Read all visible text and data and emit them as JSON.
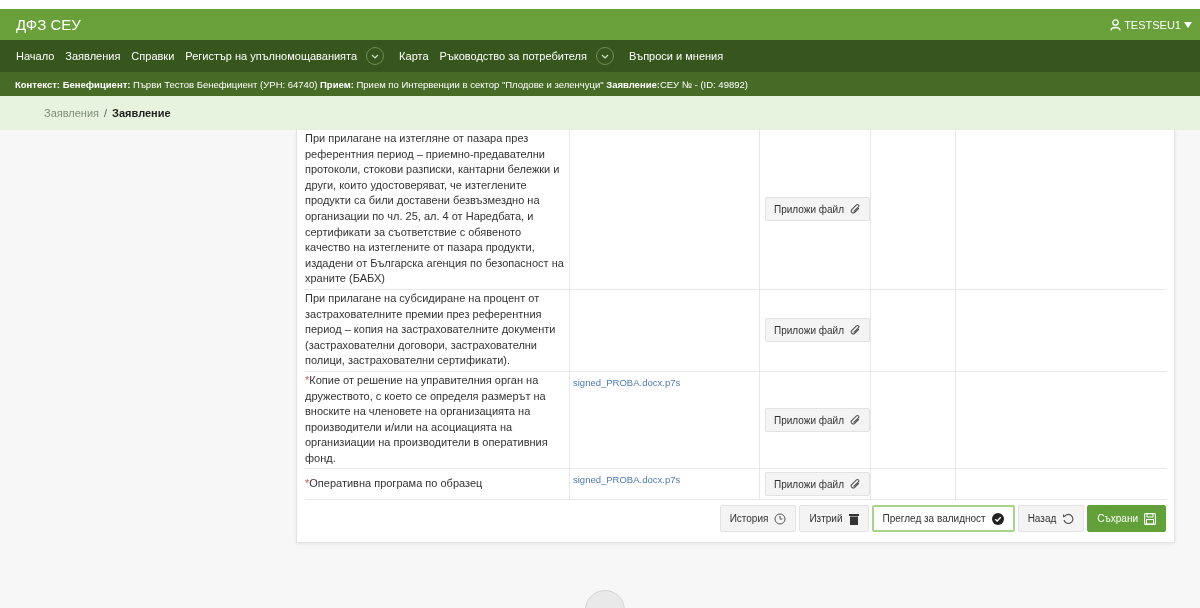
{
  "header": {
    "brand": "ДФЗ СЕУ",
    "user": "TESTSEU1"
  },
  "nav": [
    {
      "label": "Начало",
      "dropdown": false
    },
    {
      "label": "Заявления",
      "dropdown": false
    },
    {
      "label": "Справки",
      "dropdown": false
    },
    {
      "label": "Регистър на упълномощаванията",
      "dropdown": true
    },
    {
      "label": "Карта",
      "dropdown": false
    },
    {
      "label": "Ръководство за потребителя",
      "dropdown": true
    },
    {
      "label": "Въпроси и мнения",
      "dropdown": false
    }
  ],
  "context": "**Контекст: Бенефициент:** Първи Тестов Бенефициент (УРН: 64740) **Прием:** Прием по Интервенции в сектор \"Плодове и зеленчуци\" **Заявление:**СЕУ № - (ID: 49892)",
  "breadcrumb": [
    {
      "label": "Заявления",
      "current": false
    },
    {
      "label": "Заявление",
      "current": true
    }
  ],
  "breadcrumb_separator": "/",
  "required_mark": "*",
  "documents": [
    {
      "text": "При прилагане на изтегляне от пазара през референтния период – приемно-предавателни протоколи, стокови разписки, кантарни бележки и други, които удостоверяват, че изтеглените продукти са били доставени безвъзмездно на организации по чл. 25, ал. 4 от Наредбата, и сертификати за съответствие с обявеното качество на изтеглените от пазара продукти, издадени от Българска агенция по безопасност на храните (БАБХ)",
      "required": false,
      "attach": "Приложи файл"
    },
    {
      "text": "При прилагане на субсидиране на процент от застрахователните премии през референтния период – копия на застрахователните документи (застрахователни договори, застрахователни полици, застрахователни сертификати).",
      "required": false,
      "attach": "Приложи файл"
    },
    {
      "text": "Копие от решение на управителния орган на дружеството, с което се определя размерът на вноските на членовете на организацията на производители и/или на асоциацията на организиации на производители в оперативния фонд.",
      "required": true,
      "file": "signed_PROBA.docx.p7s",
      "attach": "Приложи файл"
    },
    {
      "text": "Оперативна програма по образец",
      "required": true,
      "file": "signed_PROBA.docx.p7s",
      "attach": "Приложи файл"
    }
  ],
  "actions": [
    {
      "label": "История",
      "kind": "history"
    },
    {
      "label": "Изтрий",
      "kind": "delete"
    },
    {
      "label": "Преглед за валидност",
      "kind": "validate"
    },
    {
      "label": "Назад",
      "kind": "back"
    },
    {
      "label": "Съхрани",
      "kind": "save"
    }
  ]
}
